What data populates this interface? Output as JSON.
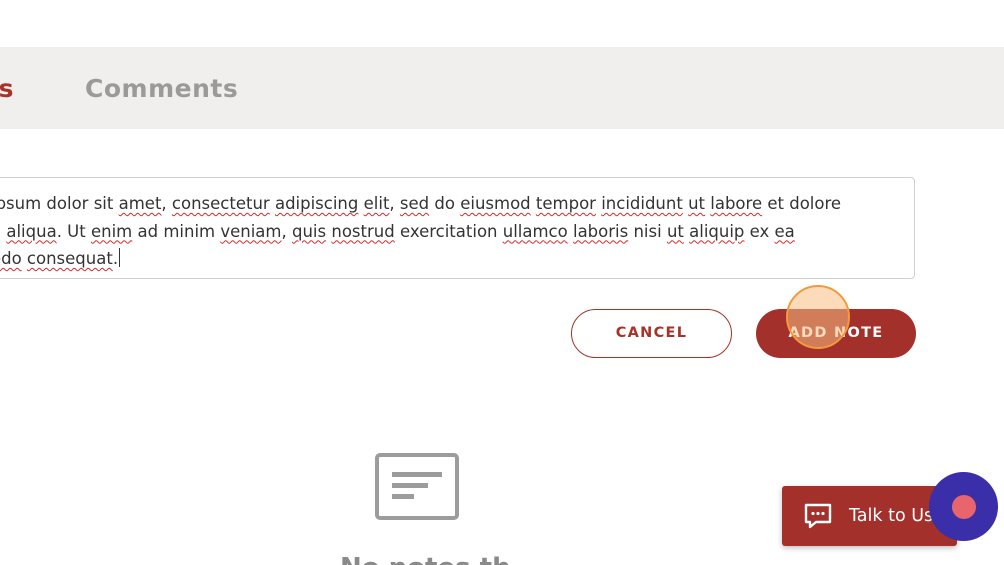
{
  "tabs": {
    "notes_label_visible": "s",
    "comments_label": "Comments"
  },
  "note_input": {
    "line1": [
      {
        "t": "ipsum",
        "s": false
      },
      {
        "t": " dolor sit ",
        "s": false
      },
      {
        "t": "amet",
        "s": true
      },
      {
        "t": ", ",
        "s": false
      },
      {
        "t": "consectetur",
        "s": true
      },
      {
        "t": " ",
        "s": false
      },
      {
        "t": "adipiscing",
        "s": true
      },
      {
        "t": " ",
        "s": false
      },
      {
        "t": "elit",
        "s": true
      },
      {
        "t": ", ",
        "s": false
      },
      {
        "t": "sed",
        "s": true
      },
      {
        "t": " do ",
        "s": false
      },
      {
        "t": "eiusmod",
        "s": true
      },
      {
        "t": " ",
        "s": false
      },
      {
        "t": "tempor",
        "s": true
      },
      {
        "t": " ",
        "s": false
      },
      {
        "t": "incididunt",
        "s": true
      },
      {
        "t": " ",
        "s": false
      },
      {
        "t": "ut",
        "s": true
      },
      {
        "t": " ",
        "s": false
      },
      {
        "t": "labore",
        "s": true
      },
      {
        "t": " et dolore",
        "s": false
      }
    ],
    "line2": [
      {
        "t": "a ",
        "s": false
      },
      {
        "t": "aliqua",
        "s": true
      },
      {
        "t": ". Ut ",
        "s": false
      },
      {
        "t": "enim",
        "s": true
      },
      {
        "t": " ad minim ",
        "s": false
      },
      {
        "t": "veniam",
        "s": true
      },
      {
        "t": ", ",
        "s": false
      },
      {
        "t": "quis",
        "s": true
      },
      {
        "t": " ",
        "s": false
      },
      {
        "t": "nostrud",
        "s": true
      },
      {
        "t": " exercitation ",
        "s": false
      },
      {
        "t": "ullamco",
        "s": true
      },
      {
        "t": " ",
        "s": false
      },
      {
        "t": "laboris",
        "s": true
      },
      {
        "t": " nisi ",
        "s": false
      },
      {
        "t": "ut",
        "s": true
      },
      {
        "t": " ",
        "s": false
      },
      {
        "t": "aliquip",
        "s": true
      },
      {
        "t": " ex ",
        "s": false
      },
      {
        "t": "ea",
        "s": true
      }
    ],
    "line3": [
      {
        "t": "odo",
        "s": true
      },
      {
        "t": " ",
        "s": false
      },
      {
        "t": "consequat",
        "s": true
      },
      {
        "t": ".",
        "s": false
      }
    ]
  },
  "actions": {
    "cancel_label": "CANCEL",
    "add_note_label": "ADD NOTE"
  },
  "empty_state": {
    "icon": "note-lines-icon",
    "text_partial": "No notes th"
  },
  "chat": {
    "label": "Talk to Us",
    "icon": "chat-bubble-icon"
  },
  "widget": {
    "icon": "live-chat-widget-icon"
  },
  "colors": {
    "brand_red": "#a3302a",
    "tab_bg": "#f1efed",
    "widget_blue": "#3a2fa8",
    "widget_dot": "#e8656d",
    "inactive_tab": "#9c9a98"
  }
}
